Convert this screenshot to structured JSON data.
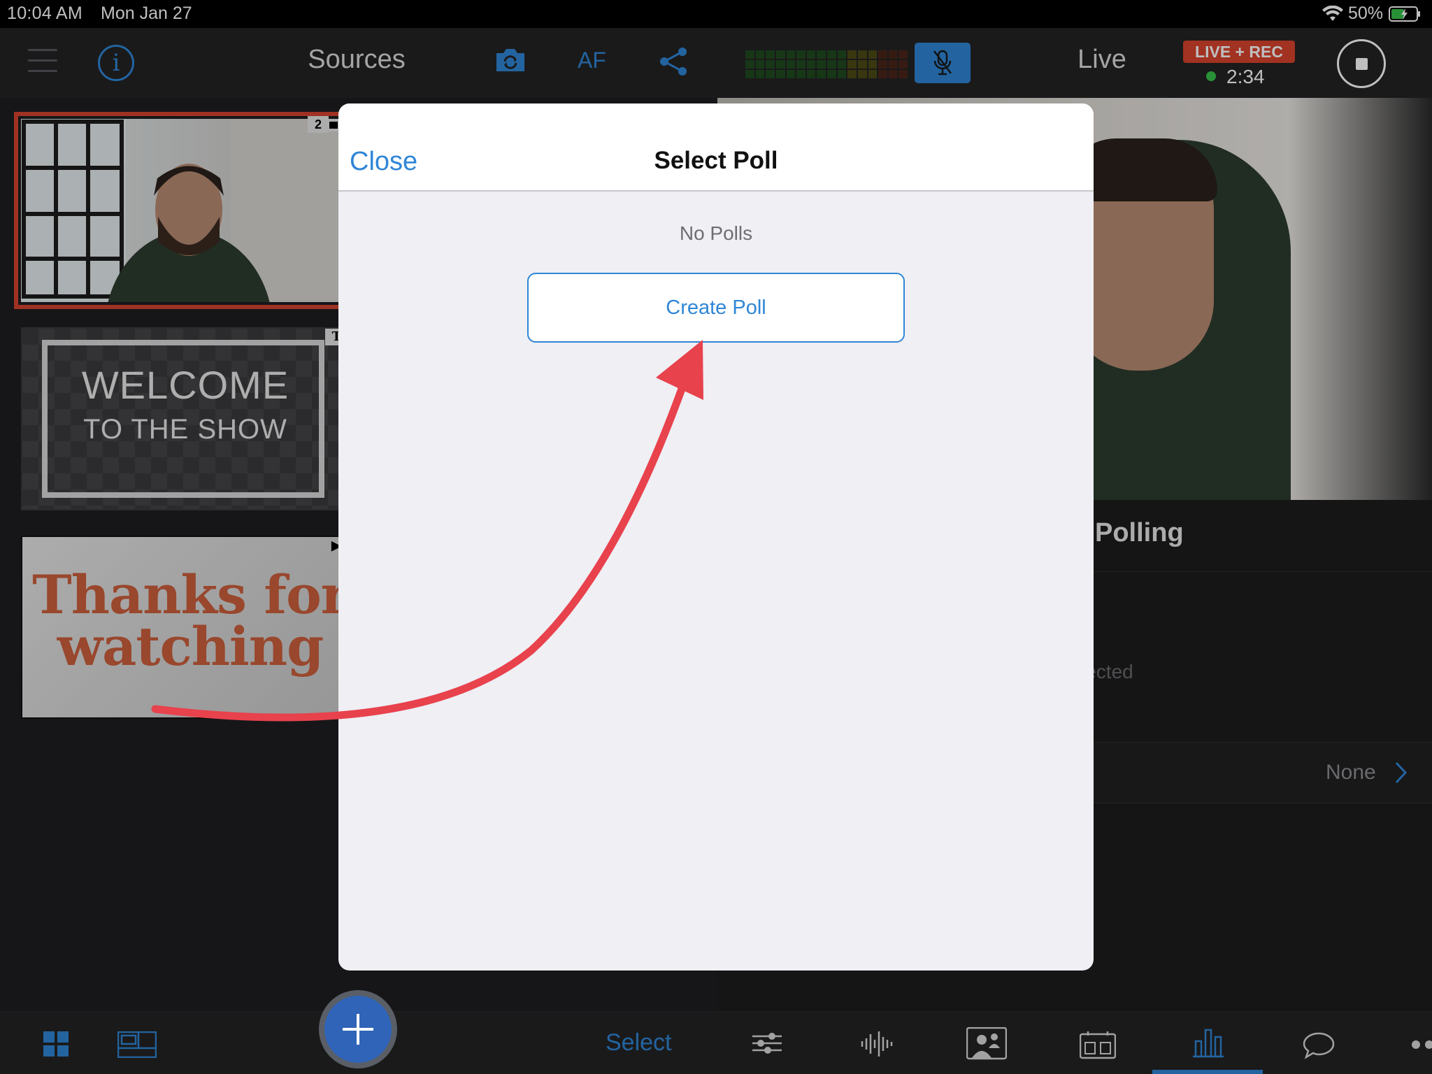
{
  "status_bar": {
    "time": "10:04 AM",
    "date": "Mon Jan 27",
    "battery": "50%"
  },
  "left_toolbar": {
    "title": "Sources",
    "af_label": "AF"
  },
  "right_toolbar": {
    "title": "Live",
    "live_badge": "LIVE + REC",
    "timer": "2:34"
  },
  "sources": [
    {
      "type": "camera",
      "badge": "2"
    },
    {
      "type": "title",
      "badge": "T",
      "line1": "WELCOME",
      "line2": "TO THE SHOW"
    },
    {
      "type": "media",
      "badge": "▶",
      "line1": "Thanks for",
      "line2": "watching"
    }
  ],
  "polling": {
    "title": "Polling",
    "selected_text": "lected",
    "row_value": "None"
  },
  "bottom_bar": {
    "select_label": "Select"
  },
  "modal": {
    "close_label": "Close",
    "title": "Select Poll",
    "empty_text": "No Polls",
    "create_label": "Create Poll"
  },
  "colors": {
    "accent": "#2f86d6",
    "live": "#d9432d",
    "selected_border": "#d6432f",
    "arrow": "#e8424d"
  }
}
